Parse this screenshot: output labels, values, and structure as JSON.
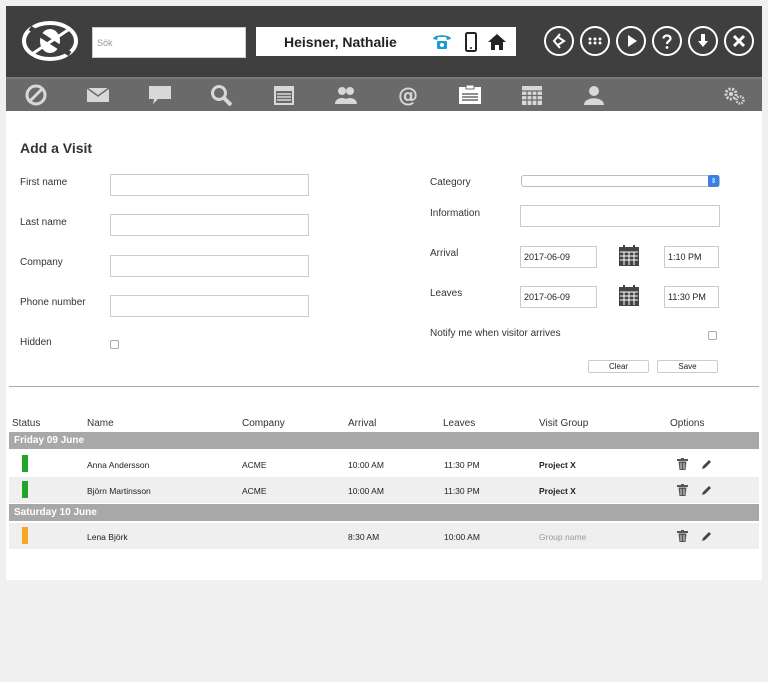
{
  "header": {
    "search": {
      "placeholder": "Sök",
      "value": ""
    },
    "user_name": "Heisner, Nathalie",
    "user_icons": [
      "phone-icon",
      "mobile-icon",
      "home-icon"
    ],
    "toolbar_buttons": [
      "transfer-icon",
      "apps-icon",
      "play-icon",
      "help-icon",
      "download-icon",
      "close-icon"
    ]
  },
  "nav": {
    "items": [
      "block-icon",
      "mail-icon",
      "chat-icon",
      "search-icon",
      "calendar-icon",
      "people-icon",
      "at-icon",
      "visits-icon",
      "schedule-icon",
      "person-icon"
    ],
    "active": "visits-icon",
    "settings": "gears-icon"
  },
  "form": {
    "title": "Add a Visit",
    "first_name_label": "First name",
    "last_name_label": "Last name",
    "company_label": "Company",
    "phone_label": "Phone number",
    "hidden_label": "Hidden",
    "category_label": "Category",
    "information_label": "Information",
    "arrival_label": "Arrival",
    "arrival_date": "2017-06-09",
    "arrival_time": "1:10 PM",
    "leaves_label": "Leaves",
    "leaves_date": "2017-06-09",
    "leaves_time": "11:30 PM",
    "notify_label": "Notify me when visitor arrives",
    "clear_label": "Clear",
    "save_label": "Save"
  },
  "table": {
    "headers": {
      "status": "Status",
      "name": "Name",
      "company": "Company",
      "arrival": "Arrival",
      "leaves": "Leaves",
      "group": "Visit Group",
      "options": "Options"
    },
    "groups": [
      {
        "label": "Friday 09 June",
        "rows": [
          {
            "status_color": "#22a32a",
            "name": "Anna Andersson",
            "company": "ACME",
            "arrival": "10:00 AM",
            "leaves": "11:30 PM",
            "group": "Project X",
            "group_placeholder": false
          },
          {
            "status_color": "#22a32a",
            "name": "Björn Martinsson",
            "company": "ACME",
            "arrival": "10:00 AM",
            "leaves": "11:30 PM",
            "group": "Project X",
            "group_placeholder": false
          }
        ]
      },
      {
        "label": "Saturday 10 June",
        "rows": [
          {
            "status_color": "#f5a623",
            "name": "Lena Björk",
            "company": "",
            "arrival": "8:30 AM",
            "leaves": "10:00 AM",
            "group": "Group name",
            "group_placeholder": true
          }
        ]
      }
    ]
  }
}
